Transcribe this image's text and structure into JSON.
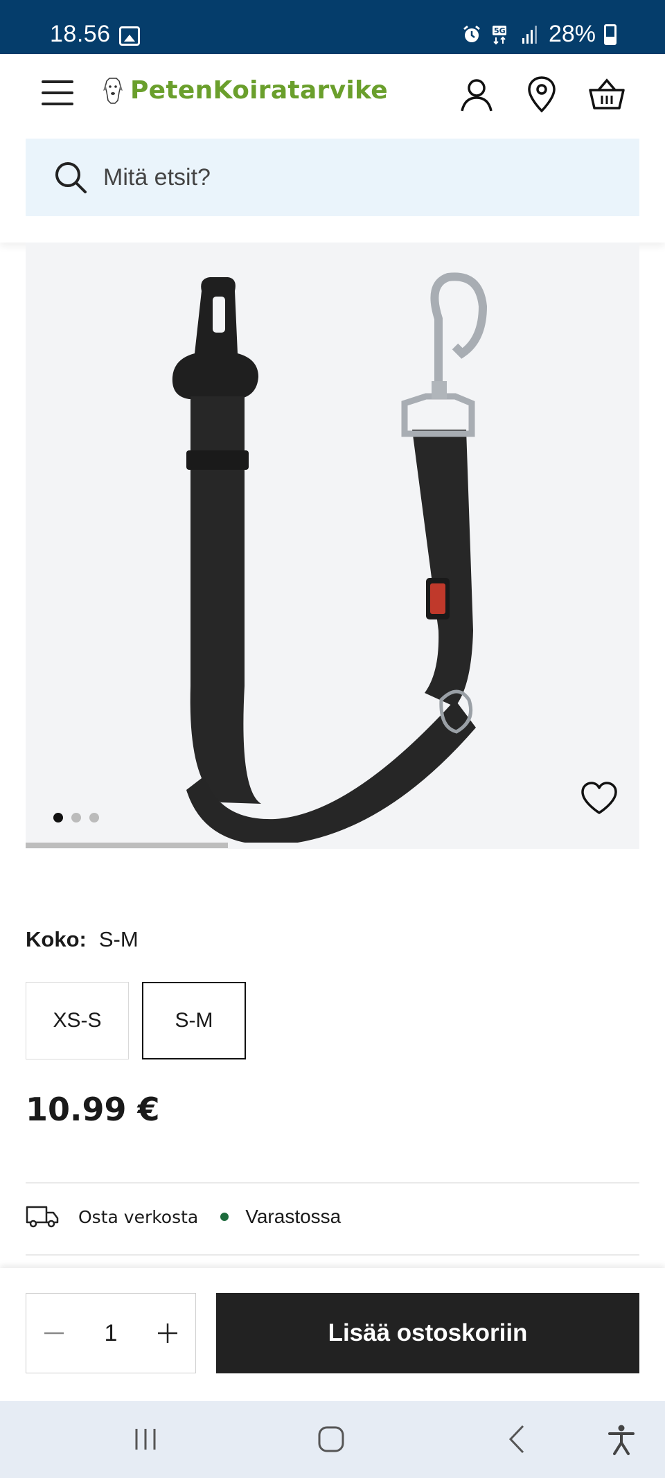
{
  "status_bar": {
    "time": "18.56",
    "battery": "28%",
    "icons": [
      "gallery-icon",
      "alarm-icon",
      "5g-icon",
      "signal-icon",
      "battery-icon"
    ]
  },
  "header": {
    "logo_text": "PetenKoiratarvike",
    "icons": [
      "menu-icon",
      "user-icon",
      "location-pin-icon",
      "basket-icon"
    ]
  },
  "search": {
    "placeholder": "Mitä etsit?"
  },
  "gallery": {
    "image_count": 3,
    "active_index": 0,
    "scroll_progress": 0.33,
    "favorite_icon": "heart-icon"
  },
  "size": {
    "label": "Koko:",
    "selected": "S-M",
    "options": [
      "XS-S",
      "S-M"
    ]
  },
  "price": "10.99 €",
  "stock": {
    "channel": "Osta verkosta",
    "status": "Varastossa",
    "status_color": "#1d6b3c",
    "icon": "truck-icon"
  },
  "buy": {
    "quantity": "1",
    "add_label": "Lisää ostoskoriin"
  },
  "colors": {
    "status_bar": "#053d6b",
    "brand_green": "#6a9f2c",
    "search_bg": "#eaf4fb",
    "button_dark": "#222222"
  }
}
